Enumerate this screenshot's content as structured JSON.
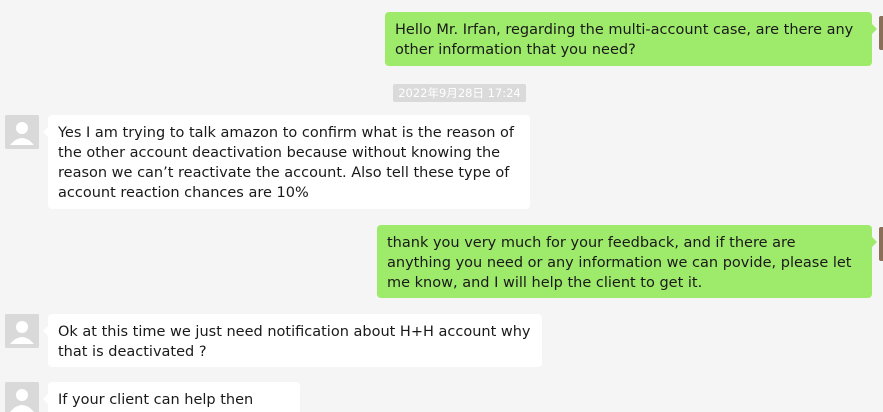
{
  "messages": [
    {
      "text": "Hello Mr. Irfan, regarding the multi-account case, are there any other information that you need?"
    },
    {
      "text": "Yes I am trying to talk amazon to confirm what is the reason of  the other account deactivation because without knowing the reason we can’t reactivate the account. Also tell these type of account reaction chances are 10%"
    },
    {
      "text": "thank you very much for your feedback, and if there are anything you need or any information we can povide, please let me know, and I will help the client to get it."
    },
    {
      "text": "Ok at this time we just need notification about H+H account why that is deactivated ?"
    },
    {
      "text": "If your client can help then please"
    }
  ],
  "timestamp": "2022年9月28日 17:24",
  "icons": {
    "contact_avatar": "default-user-avatar-icon",
    "self_avatar": "user-photo-avatar"
  },
  "colors": {
    "background": "#f5f5f5",
    "outgoing_bubble": "#9eea6a",
    "incoming_bubble": "#ffffff",
    "timestamp_bg": "#dadada",
    "avatar_placeholder": "#d9d9d9"
  }
}
